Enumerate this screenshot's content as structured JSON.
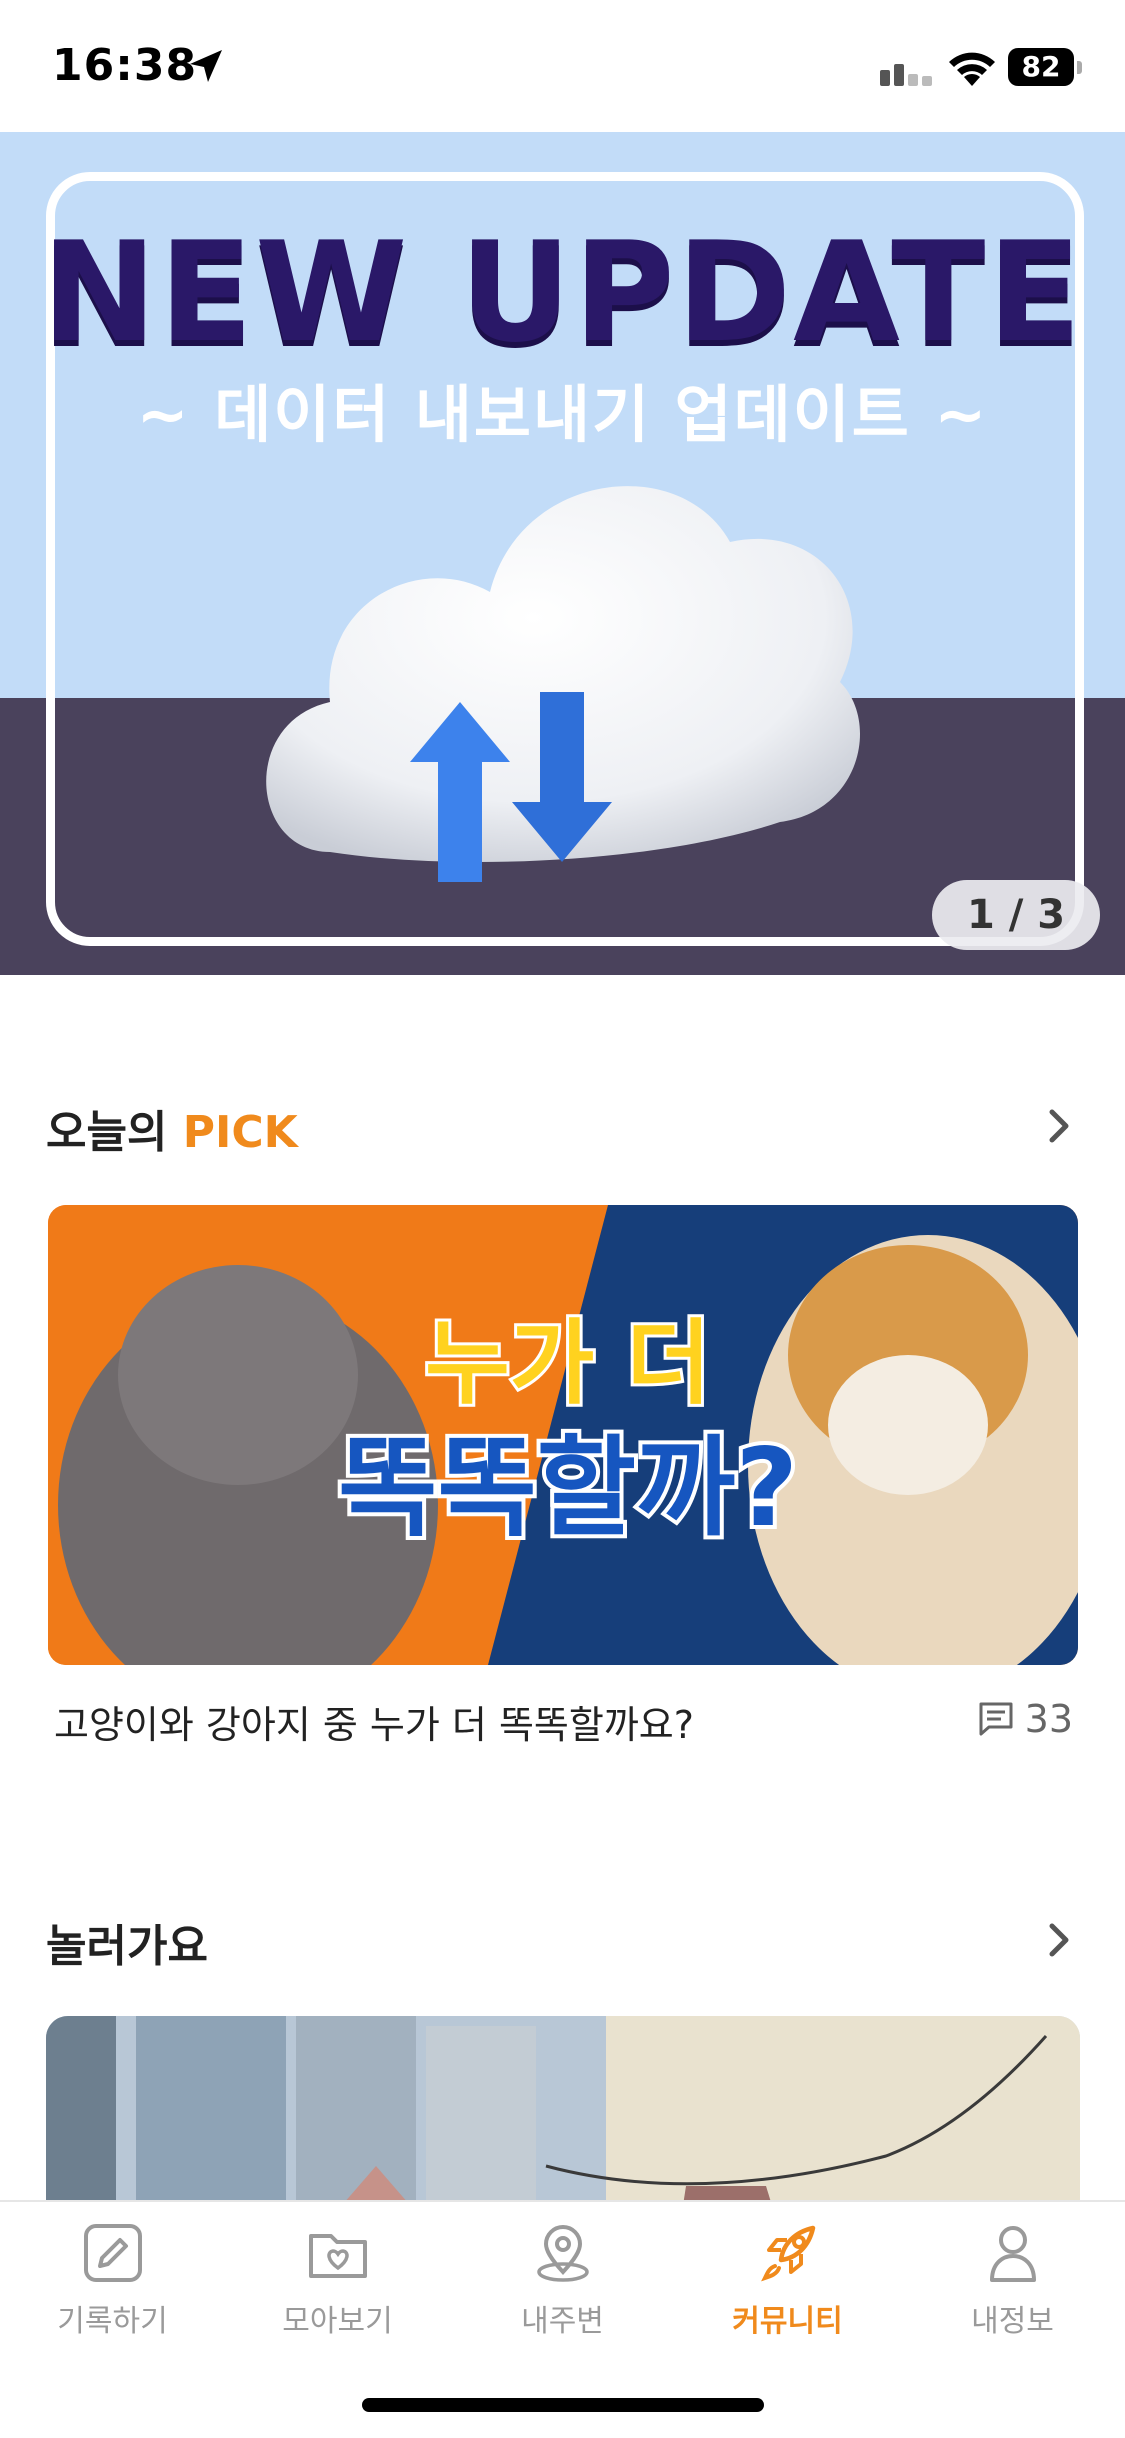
{
  "status_bar": {
    "time": "16:38",
    "battery": "82",
    "icons": [
      "location-arrow-icon",
      "signal-icon",
      "wifi-icon",
      "battery-icon"
    ]
  },
  "banner": {
    "headline": "NEW UPDATE",
    "subline": "~ 데이터 내보내기 업데이트 ~",
    "counter": "1 / 3",
    "illustration": "cloud-sync-icon"
  },
  "pick": {
    "title_prefix": "오늘의 ",
    "title_accent": "PICK",
    "card_text_line1": "누가 더",
    "card_text_line2": "똑똑할까?",
    "post_title": "고양이와 강아지 중 누가 더 똑똑할까요?",
    "comment_count": "33"
  },
  "going_out": {
    "title": "놀러가요"
  },
  "tabbar": {
    "items": [
      {
        "label": "기록하기",
        "icon": "pencil-icon",
        "active": false
      },
      {
        "label": "모아보기",
        "icon": "folder-heart-icon",
        "active": false
      },
      {
        "label": "내주변",
        "icon": "map-pin-icon",
        "active": false
      },
      {
        "label": "커뮤니티",
        "icon": "rocket-icon",
        "active": true
      },
      {
        "label": "내정보",
        "icon": "person-icon",
        "active": false
      }
    ]
  },
  "colors": {
    "accent": "#f08a1c",
    "banner_light": "#c2dcf8",
    "banner_dark": "#4a425c",
    "headline": "#2a1868"
  }
}
